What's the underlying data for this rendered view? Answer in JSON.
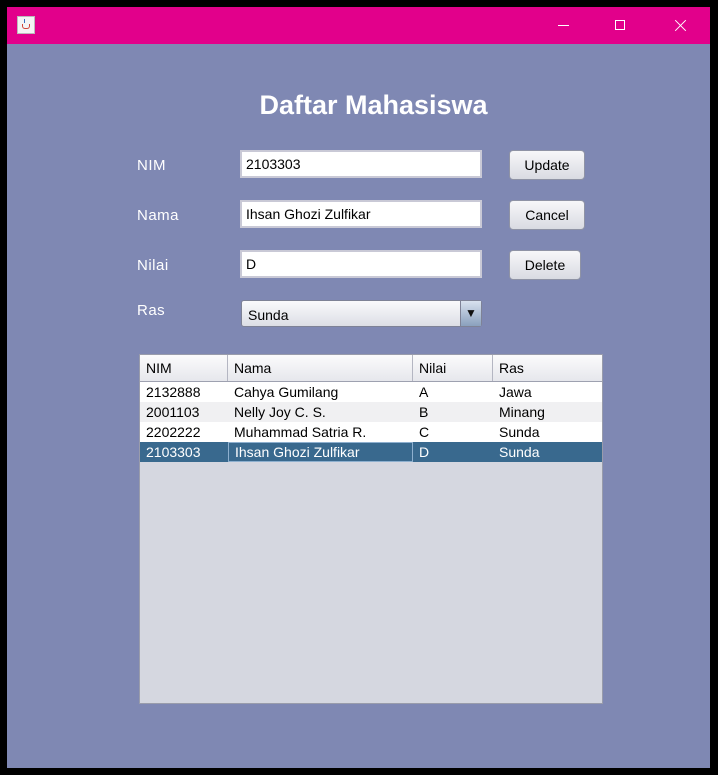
{
  "window": {
    "title": "",
    "icon": "java-cup-icon",
    "titlebar_color": "#e2008b",
    "background_color": "#7f88b3"
  },
  "form": {
    "heading": "Daftar Mahasiswa",
    "nim_label": "NIM",
    "nim_value": "2103303",
    "nama_label": "Nama",
    "nama_value": "Ihsan Ghozi Zulfikar",
    "nilai_label": "Nilai",
    "nilai_value": "D",
    "ras_label": "Ras",
    "ras_value": "Sunda"
  },
  "buttons": {
    "update": "Update",
    "cancel": "Cancel",
    "delete": "Delete"
  },
  "table": {
    "columns": [
      "NIM",
      "Nama",
      "Nilai",
      "Ras"
    ],
    "rows": [
      [
        "2132888",
        "Cahya Gumilang",
        "A",
        "Jawa"
      ],
      [
        "2001103",
        "Nelly Joy C. S.",
        "B",
        "Minang"
      ],
      [
        "2202222",
        "Muhammad Satria R.",
        "C",
        "Sunda"
      ],
      [
        "2103303",
        "Ihsan Ghozi Zulfikar",
        "D",
        "Sunda"
      ]
    ],
    "selected_row": 3,
    "selection_color": "#39698e"
  }
}
